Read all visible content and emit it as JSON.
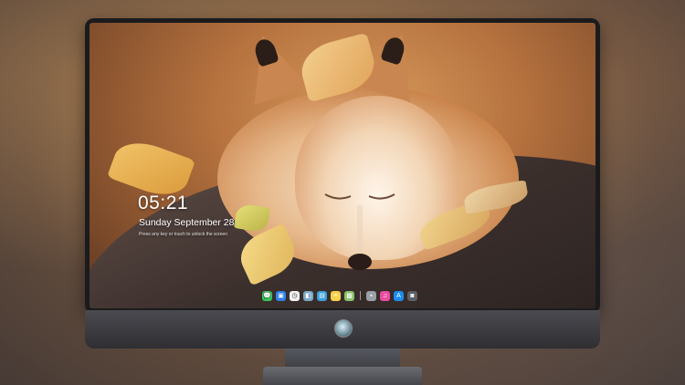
{
  "lockscreen": {
    "time": "05:21",
    "date": "Sunday September 28",
    "notice": "Press any key or touch to unlock the screen"
  },
  "dock": {
    "items": [
      {
        "name": "messages-icon",
        "glyph": "💬",
        "color": "#34c759"
      },
      {
        "name": "finder-icon",
        "glyph": "▣",
        "color": "#2f80ed"
      },
      {
        "name": "clock-icon",
        "glyph": "◷",
        "color": "#f2f2f2"
      },
      {
        "name": "preview-icon",
        "glyph": "◧",
        "color": "#7aa7c7"
      },
      {
        "name": "clapper-icon",
        "glyph": "▤",
        "color": "#3ba0d8"
      },
      {
        "name": "notes-icon",
        "glyph": "≡",
        "color": "#f7d24a"
      },
      {
        "name": "photos-icon",
        "glyph": "▩",
        "color": "#8ac06c"
      },
      {
        "name": "folder-icon",
        "glyph": "▪",
        "color": "#9aa0a8"
      },
      {
        "name": "music-icon",
        "glyph": "♫",
        "color": "#e94ca0"
      },
      {
        "name": "app-store-icon",
        "glyph": "A",
        "color": "#1c8cf0"
      },
      {
        "name": "camera-icon",
        "glyph": "◙",
        "color": "#5c6066"
      }
    ]
  },
  "colors": {
    "monitor_bezel": "#1b1b1d",
    "wallpaper_warm": "#d79a5c",
    "log_dark": "#3b2f2c"
  }
}
